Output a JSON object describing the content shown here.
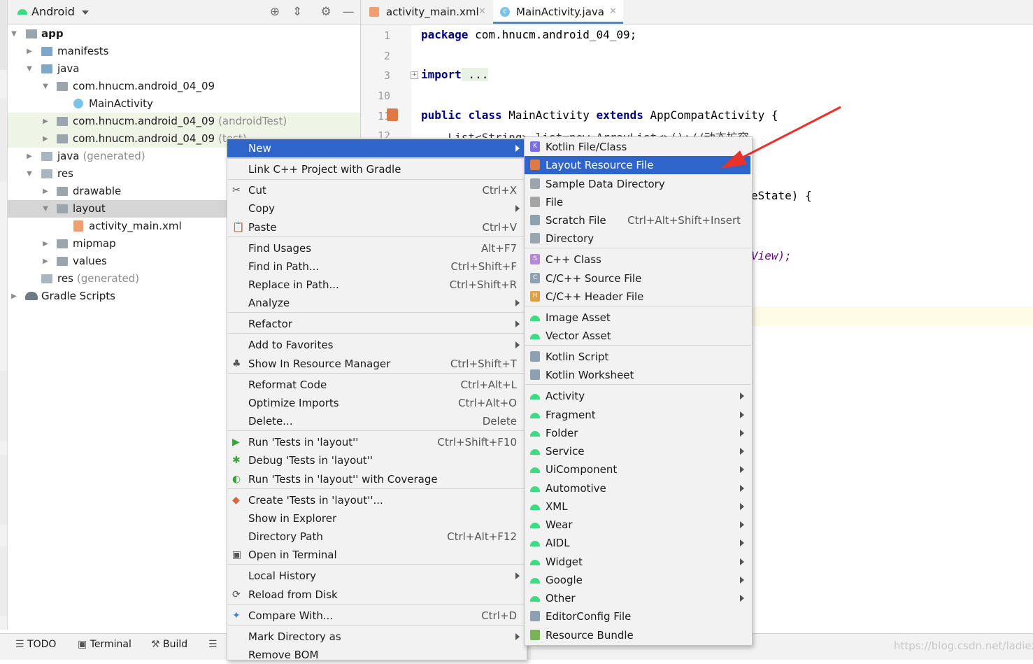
{
  "project_panel": {
    "view_name": "Android",
    "tree": [
      {
        "label": "app",
        "bold": true
      },
      {
        "label": "manifests"
      },
      {
        "label": "java"
      },
      {
        "label": "com.hnucm.android_04_09"
      },
      {
        "label": "MainActivity"
      },
      {
        "label": "com.hnucm.android_04_09",
        "suffix": "(androidTest)"
      },
      {
        "label": "com.hnucm.android_04_09",
        "suffix": "(test)"
      },
      {
        "label": "java",
        "suffix": "(generated)"
      },
      {
        "label": "res"
      },
      {
        "label": "drawable"
      },
      {
        "label": "layout"
      },
      {
        "label": "activity_main.xml"
      },
      {
        "label": "mipmap"
      },
      {
        "label": "values"
      },
      {
        "label": "res",
        "suffix": "(generated)"
      },
      {
        "label": "Gradle Scripts"
      }
    ]
  },
  "editor": {
    "tabs": [
      {
        "label": "activity_main.xml",
        "active": false
      },
      {
        "label": "MainActivity.java",
        "active": true
      }
    ],
    "line_numbers": [
      "1",
      "2",
      "3",
      "10",
      "11",
      "12"
    ],
    "code": {
      "l1_kw": "package",
      "l1_rest": " com.hnucm.android_04_09;",
      "l3_kw": "import",
      "l3_rest": " ...",
      "l11_kw1": "public",
      "l11_kw2": "class",
      "l11_mid": " MainActivity ",
      "l11_kw3": "extends",
      "l11_rest": " AppCompatActivity {",
      "l12": "    List<String> list=new ArrayList<>();//动态扩容",
      "frag1": "eState) {",
      "frag2": "View);"
    }
  },
  "context_menu": {
    "items": [
      {
        "label": "New",
        "submenu": true,
        "selected": true
      },
      {
        "label": "Link C++ Project with Gradle"
      },
      {
        "label": "Cut",
        "shortcut": "Ctrl+X"
      },
      {
        "label": "Copy",
        "submenu": true
      },
      {
        "label": "Paste",
        "shortcut": "Ctrl+V"
      },
      {
        "label": "Find Usages",
        "shortcut": "Alt+F7"
      },
      {
        "label": "Find in Path...",
        "shortcut": "Ctrl+Shift+F"
      },
      {
        "label": "Replace in Path...",
        "shortcut": "Ctrl+Shift+R"
      },
      {
        "label": "Analyze",
        "submenu": true
      },
      {
        "label": "Refactor",
        "submenu": true
      },
      {
        "label": "Add to Favorites",
        "submenu": true
      },
      {
        "label": "Show In Resource Manager",
        "shortcut": "Ctrl+Shift+T"
      },
      {
        "label": "Reformat Code",
        "shortcut": "Ctrl+Alt+L"
      },
      {
        "label": "Optimize Imports",
        "shortcut": "Ctrl+Alt+O"
      },
      {
        "label": "Delete...",
        "shortcut": "Delete"
      },
      {
        "label": "Run 'Tests in 'layout''",
        "shortcut": "Ctrl+Shift+F10"
      },
      {
        "label": "Debug 'Tests in 'layout''"
      },
      {
        "label": "Run 'Tests in 'layout'' with Coverage"
      },
      {
        "label": "Create 'Tests in 'layout''..."
      },
      {
        "label": "Show in Explorer"
      },
      {
        "label": "Directory Path",
        "shortcut": "Ctrl+Alt+F12"
      },
      {
        "label": "Open in Terminal"
      },
      {
        "label": "Local History",
        "submenu": true
      },
      {
        "label": "Reload from Disk"
      },
      {
        "label": "Compare With...",
        "shortcut": "Ctrl+D"
      },
      {
        "label": "Mark Directory as",
        "submenu": true
      },
      {
        "label": "Remove BOM"
      }
    ]
  },
  "new_submenu": {
    "items": [
      {
        "label": "Kotlin File/Class"
      },
      {
        "label": "Layout Resource File",
        "selected": true
      },
      {
        "label": "Sample Data Directory"
      },
      {
        "label": "File"
      },
      {
        "label": "Scratch File",
        "shortcut": "Ctrl+Alt+Shift+Insert"
      },
      {
        "label": "Directory"
      },
      {
        "label": "C++ Class"
      },
      {
        "label": "C/C++ Source File"
      },
      {
        "label": "C/C++ Header File"
      },
      {
        "label": "Image Asset"
      },
      {
        "label": "Vector Asset"
      },
      {
        "label": "Kotlin Script"
      },
      {
        "label": "Kotlin Worksheet"
      },
      {
        "label": "Activity",
        "submenu": true
      },
      {
        "label": "Fragment",
        "submenu": true
      },
      {
        "label": "Folder",
        "submenu": true
      },
      {
        "label": "Service",
        "submenu": true
      },
      {
        "label": "UiComponent",
        "submenu": true
      },
      {
        "label": "Automotive",
        "submenu": true
      },
      {
        "label": "XML",
        "submenu": true
      },
      {
        "label": "Wear",
        "submenu": true
      },
      {
        "label": "AIDL",
        "submenu": true
      },
      {
        "label": "Widget",
        "submenu": true
      },
      {
        "label": "Google",
        "submenu": true
      },
      {
        "label": "Other",
        "submenu": true
      },
      {
        "label": "EditorConfig File"
      },
      {
        "label": "Resource Bundle"
      }
    ]
  },
  "bottom_bar": {
    "tools": [
      "TODO",
      "Terminal",
      "Build"
    ],
    "watermark": "https://blog.csdn.net/ladiez"
  },
  "colors": {
    "selection": "#2f65ca",
    "keyword": "#000080",
    "android_green": "#3ddc84",
    "annotation_arrow": "#e8322a"
  }
}
